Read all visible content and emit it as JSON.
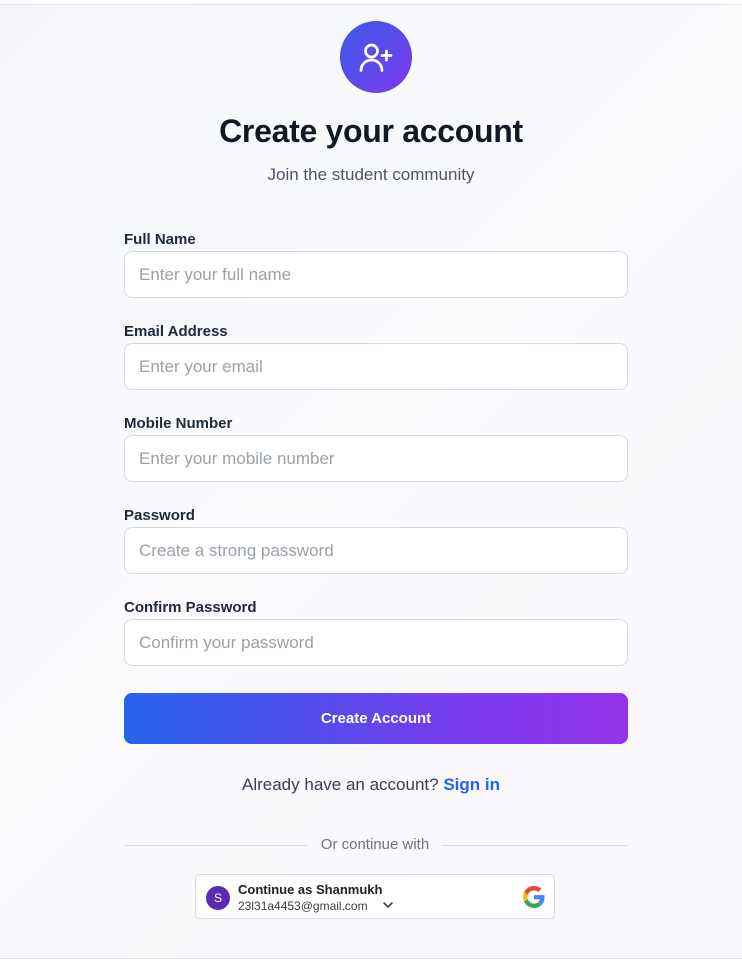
{
  "header": {
    "title": "Create your account",
    "subtitle": "Join the student community",
    "icon": "user-plus-icon"
  },
  "form": {
    "full_name": {
      "label": "Full Name",
      "placeholder": "Enter your full name",
      "value": ""
    },
    "email": {
      "label": "Email Address",
      "placeholder": "Enter your email",
      "value": ""
    },
    "mobile": {
      "label": "Mobile Number",
      "placeholder": "Enter your mobile number",
      "value": ""
    },
    "password": {
      "label": "Password",
      "placeholder": "Create a strong password",
      "value": ""
    },
    "confirm_password": {
      "label": "Confirm Password",
      "placeholder": "Confirm your password",
      "value": ""
    },
    "submit_label": "Create Account"
  },
  "signin": {
    "prompt": "Already have an account?",
    "link_label": "Sign in"
  },
  "divider": {
    "text": "Or continue with"
  },
  "google": {
    "avatar_initial": "S",
    "title": "Continue as Shanmukh",
    "email": "23l31a4453@gmail.com",
    "icons": [
      "chevron-down-icon",
      "google-logo-icon"
    ]
  },
  "colors": {
    "accent_start": "#2563eb",
    "accent_end": "#9333ea",
    "link": "#2563eb",
    "title": "#111827"
  }
}
